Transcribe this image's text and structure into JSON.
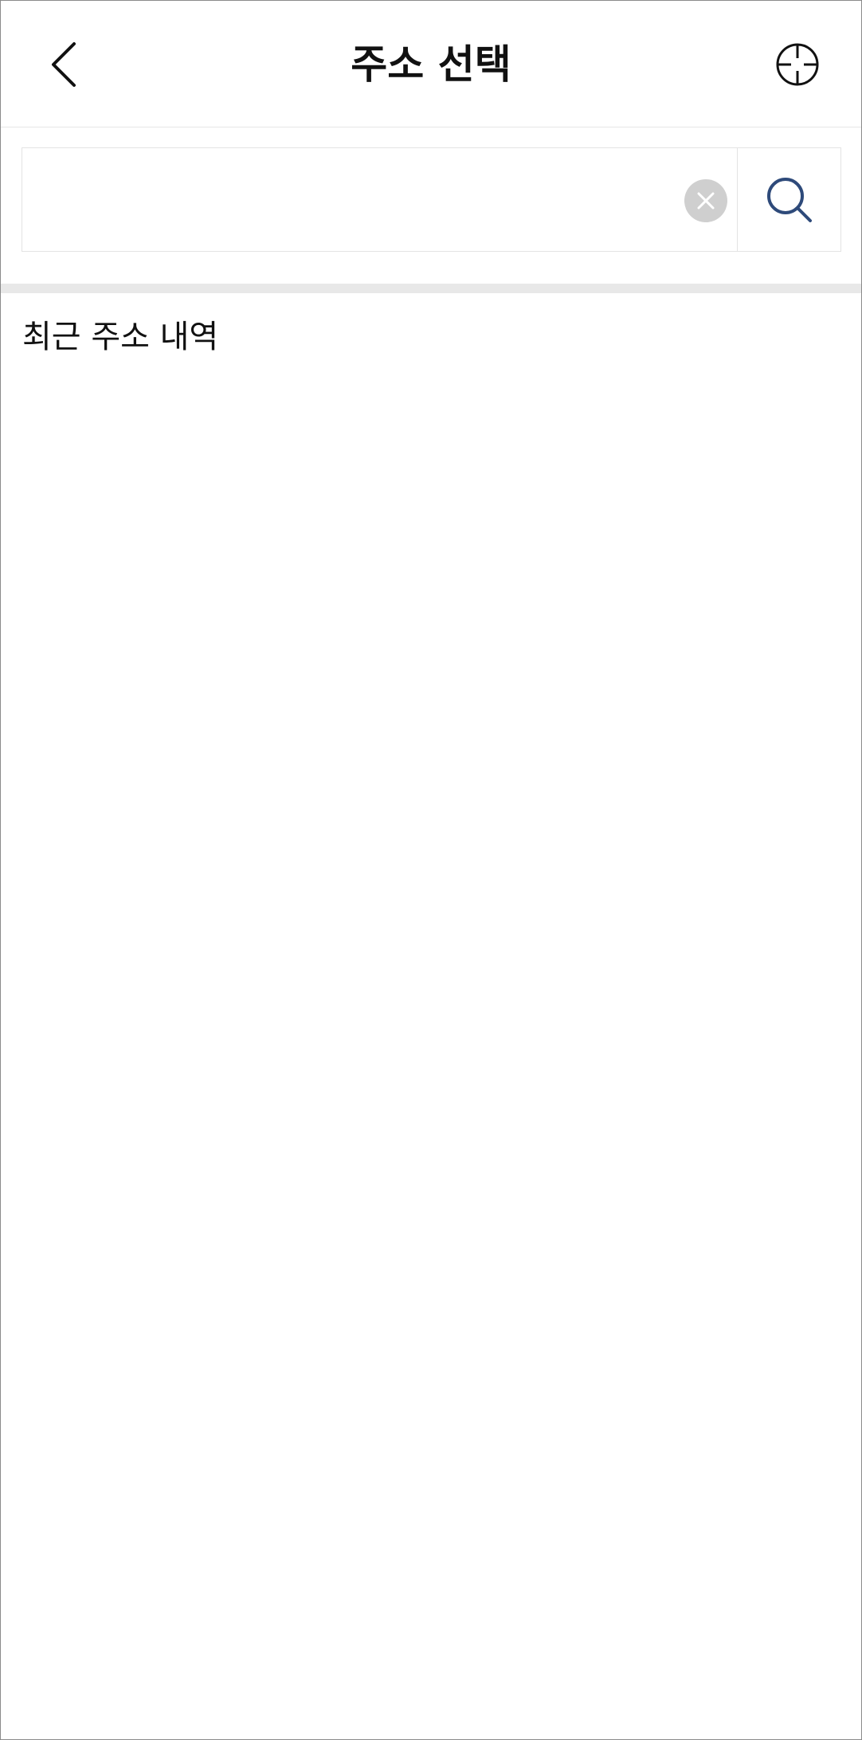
{
  "header": {
    "title": "주소 선택",
    "back_icon": "chevron-left-icon",
    "locate_icon": "crosshair-icon"
  },
  "search": {
    "value": "",
    "placeholder": "",
    "clear_icon": "close-icon",
    "search_icon": "search-icon",
    "accent_color": "#2e4a7a"
  },
  "recent": {
    "title": "최근 주소 내역",
    "items": []
  }
}
